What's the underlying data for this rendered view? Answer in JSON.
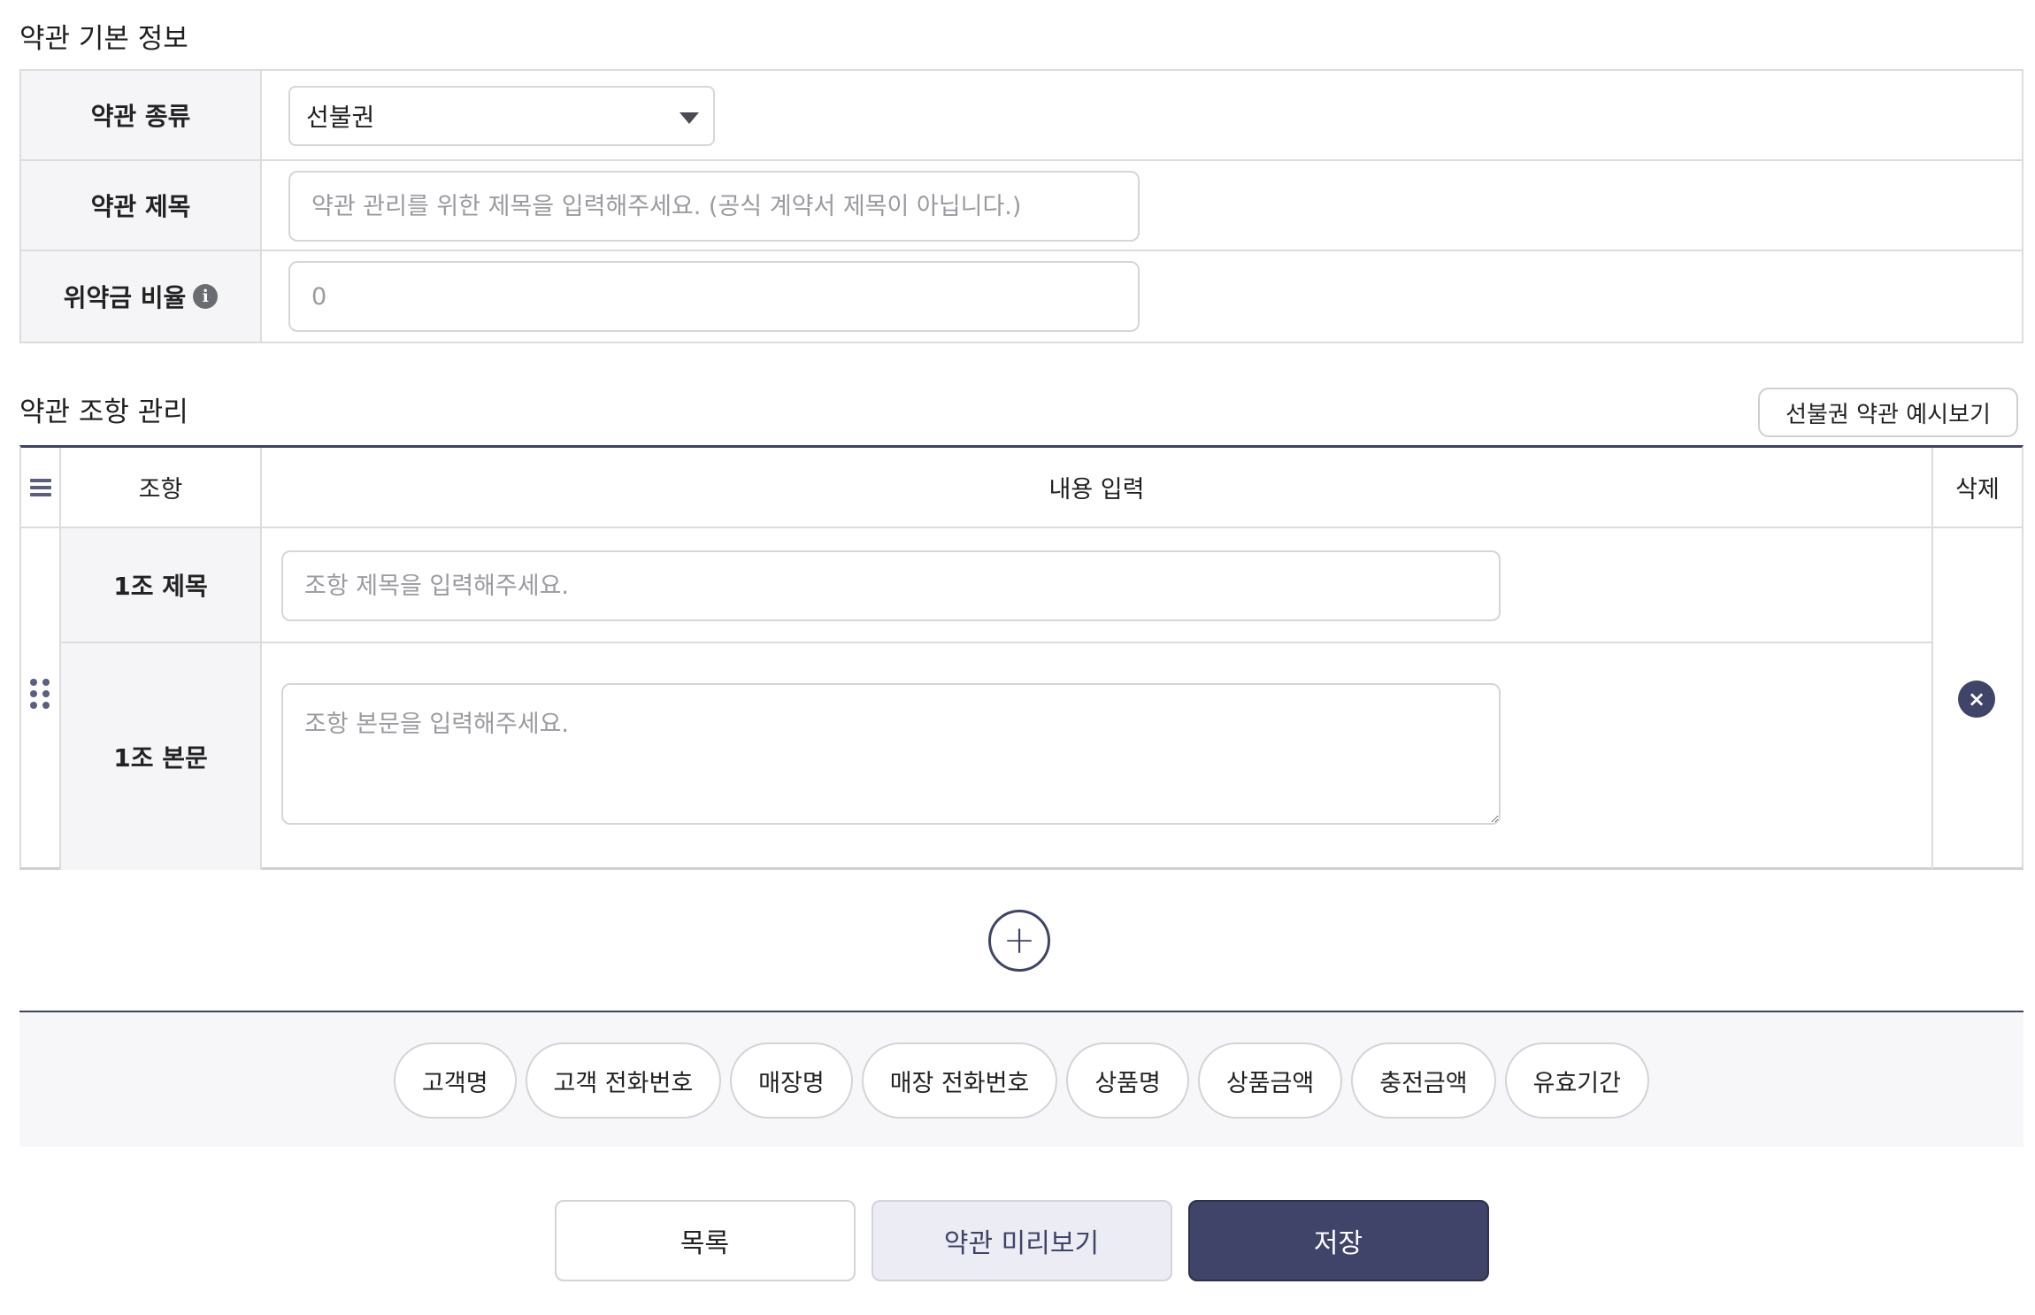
{
  "basic_info": {
    "section_title": "약관 기본 정보",
    "terms_type_label": "약관 종류",
    "terms_type_value": "선불권",
    "terms_title_label": "약관 제목",
    "terms_title_placeholder": "약관 관리를 위한 제목을 입력해주세요. (공식 계약서 제목이 아닙니다.)",
    "penalty_label": "위약금 비율",
    "penalty_info_icon": "i",
    "penalty_placeholder": "0"
  },
  "clause": {
    "section_title": "약관 조항 관리",
    "example_button": "선불권 약관 예시보기",
    "headers": {
      "clause": "조항",
      "content": "내용 입력",
      "delete": "삭제"
    },
    "rows": [
      {
        "title_label": "1조 제목",
        "title_placeholder": "조항 제목을 입력해주세요.",
        "body_label": "1조 본문",
        "body_placeholder": "조항 본문을 입력해주세요."
      }
    ],
    "delete_icon": "×",
    "add_icon": "+"
  },
  "variables": [
    "고객명",
    "고객 전화번호",
    "매장명",
    "매장 전화번호",
    "상품명",
    "상품금액",
    "충전금액",
    "유효기간"
  ],
  "actions": {
    "list": "목록",
    "preview": "약관 미리보기",
    "save": "저장"
  },
  "colors": {
    "primary": "#3f4468",
    "border": "#dcdcdc",
    "label_bg": "#f5f5f8"
  }
}
